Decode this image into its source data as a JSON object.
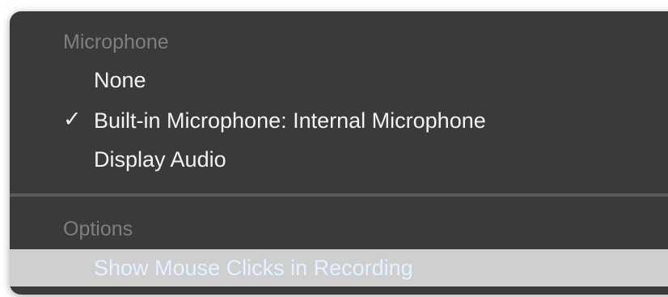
{
  "menu": {
    "microphone_header": "Microphone",
    "microphone_items": [
      {
        "label": "None",
        "checked": false
      },
      {
        "label": "Built-in Microphone: Internal Microphone",
        "checked": true
      },
      {
        "label": "Display Audio",
        "checked": false
      }
    ],
    "check_glyph": "✓",
    "options_header": "Options",
    "options_items": [
      {
        "label": "Show Mouse Clicks in Recording",
        "highlighted": true
      }
    ]
  }
}
